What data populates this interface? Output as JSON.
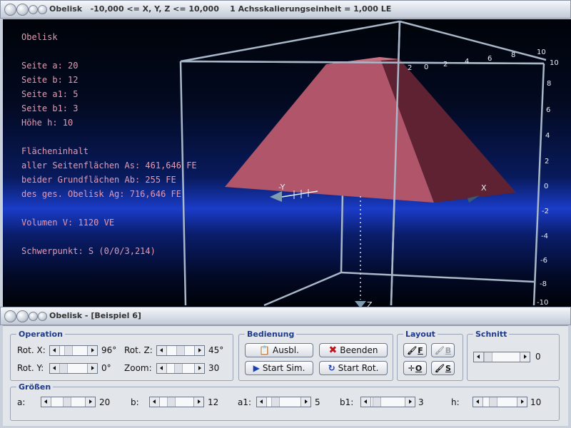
{
  "main_window": {
    "title": "Obelisk   -10,000 <= X, Y, Z <= 10,000    1 Achsskalierungseinheit = 1,000 LE"
  },
  "info": {
    "heading": "Obelisk",
    "params": [
      "Seite a: 20",
      "Seite b: 12",
      "Seite a1: 5",
      "Seite b1: 3",
      "Höhe h: 10"
    ],
    "area_heading": "Flächeninhalt",
    "areas": [
      "aller Seitenflächen As: 461,646 FE",
      "beider Grundflächen Ab: 255 FE",
      "des ges. Obelisk Ag: 716,646 FE"
    ],
    "volume": "Volumen V: 1120 VE",
    "centroid": "Schwerpunkt: S (0/0/3,214)"
  },
  "axes": {
    "x_label": "X",
    "y_label": "-Y",
    "z_label": "Z",
    "top_ticks": [
      "2",
      "0",
      "2",
      "4",
      "6",
      "8",
      "10"
    ],
    "side_ticks": [
      "10",
      "8",
      "6",
      "4",
      "2",
      "0",
      "-2",
      "-4",
      "-6",
      "-8",
      "-10"
    ]
  },
  "colors": {
    "accent": "#1d3a8a",
    "info_text": "#e89ab0",
    "face_light": "#b0556a",
    "face_dark": "#5e2232"
  },
  "control_window": {
    "title": "Obelisk - [Beispiel 6]"
  },
  "operation": {
    "label": "Operation",
    "rot_x_label": "Rot. X:",
    "rot_x_value": "96°",
    "rot_y_label": "Rot. Y:",
    "rot_y_value": "0°",
    "rot_z_label": "Rot. Z:",
    "rot_z_value": "45°",
    "zoom_label": "Zoom:",
    "zoom_value": "30"
  },
  "bedienung": {
    "label": "Bedienung",
    "ausbl": "Ausbl.",
    "beenden": "Beenden",
    "start_sim": "Start Sim.",
    "start_rot": "Start Rot."
  },
  "layout": {
    "label": "Layout",
    "f": "F",
    "b": "B",
    "o": "O",
    "s": "S"
  },
  "schnitt": {
    "label": "Schnitt",
    "value": "0"
  },
  "groessen": {
    "label": "Größen",
    "a_label": "a:",
    "a_value": "20",
    "b_label": "b:",
    "b_value": "12",
    "a1_label": "a1:",
    "a1_value": "5",
    "b1_label": "b1:",
    "b1_value": "3",
    "h_label": "h:",
    "h_value": "10"
  }
}
